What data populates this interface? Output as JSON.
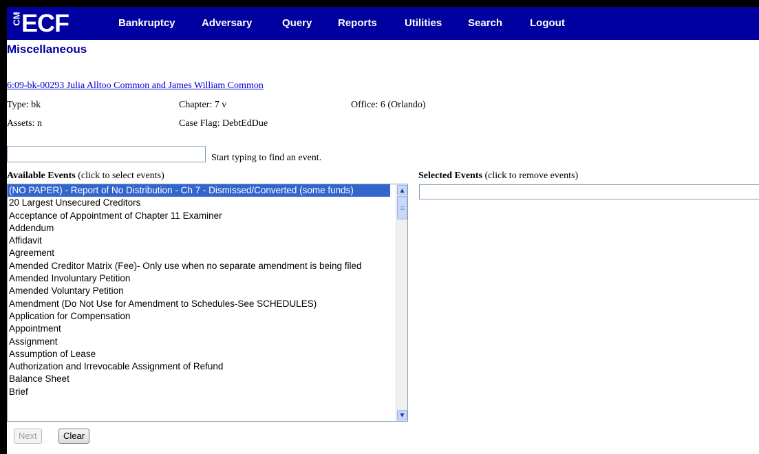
{
  "app": {
    "logo_cm": "CM",
    "logo_ecf": "ECF"
  },
  "menu": [
    {
      "label": "Bankruptcy"
    },
    {
      "label": "Adversary"
    },
    {
      "label": "Query"
    },
    {
      "label": "Reports"
    },
    {
      "label": "Utilities"
    },
    {
      "label": "Search"
    },
    {
      "label": "Logout"
    }
  ],
  "page": {
    "title": "Miscellaneous"
  },
  "case": {
    "link": "6:09-bk-00293 Julia Alltoo Common and James William Common",
    "type": "Type: bk",
    "chapter": "Chapter: 7 v",
    "office": "Office: 6 (Orlando)",
    "assets": "Assets: n",
    "case_flag": "Case Flag: DebtEdDue"
  },
  "search": {
    "value": "",
    "hint": "Start typing to find an event."
  },
  "available": {
    "label_bold": "Available Events",
    "label_note": " (click to select events)",
    "items": [
      "(NO PAPER) - Report of No Distribution - Ch 7 - Dismissed/Converted (some funds)",
      "20 Largest Unsecured Creditors",
      "Acceptance of Appointment of Chapter 11 Examiner",
      "Addendum",
      "Affidavit",
      "Agreement",
      "Amended Creditor Matrix (Fee)- Only use when no separate amendment is being filed",
      "Amended Involuntary Petition",
      "Amended Voluntary Petition",
      "Amendment (Do Not Use for Amendment to Schedules-See SCHEDULES)",
      "Application for Compensation",
      "Appointment",
      "Assignment",
      "Assumption of Lease",
      "Authorization and Irrevocable Assignment of Refund",
      "Balance Sheet",
      "Brief"
    ],
    "selected_index": 0
  },
  "selected": {
    "label_bold": "Selected Events",
    "label_note": " (click to remove events)"
  },
  "buttons": {
    "next": "Next",
    "clear": "Clear"
  },
  "icons": {
    "scroll_up": "scroll-up-arrow-icon",
    "scroll_down": "scroll-down-arrow-icon"
  }
}
